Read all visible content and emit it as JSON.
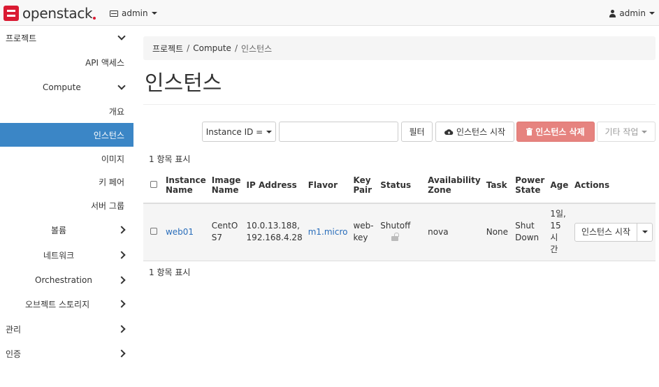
{
  "navbar": {
    "logo_text": "openstack",
    "project_selector": "admin",
    "user_menu": "admin"
  },
  "sidebar": {
    "items": [
      {
        "label": "프로젝트",
        "chevron": "down"
      },
      {
        "label": "API 액세스"
      },
      {
        "label": "Compute",
        "chevron": "down"
      },
      {
        "label": "개요"
      },
      {
        "label": "인스턴스",
        "active": true
      },
      {
        "label": "이미지"
      },
      {
        "label": "키 페어"
      },
      {
        "label": "서버 그룹"
      },
      {
        "label": "볼륨",
        "chevron": "right"
      },
      {
        "label": "네트워크",
        "chevron": "right"
      },
      {
        "label": "Orchestration",
        "chevron": "right"
      },
      {
        "label": "오브젝트 스토리지",
        "chevron": "right"
      },
      {
        "label": "관리",
        "chevron": "right"
      },
      {
        "label": "인증",
        "chevron": "right"
      }
    ]
  },
  "breadcrumb": [
    "프로젝트",
    "Compute",
    "인스턴스"
  ],
  "page_title": "인스턴스",
  "toolbar": {
    "filter_field": "Instance ID =",
    "filter_value": "",
    "filter_button": "필터",
    "start_button": "인스턴스 시작",
    "delete_button": "인스턴스 삭제",
    "more_actions": "기타 작업"
  },
  "item_count": "1 항목 표시",
  "table": {
    "headers": {
      "name": [
        "Instance",
        "Name"
      ],
      "image": [
        "Image",
        "Name"
      ],
      "ip": "IP Address",
      "flavor": "Flavor",
      "keypair": [
        "Key",
        "Pair"
      ],
      "status": "Status",
      "az": [
        "Availability",
        "Zone"
      ],
      "task": "Task",
      "power": [
        "Power",
        "State"
      ],
      "age": "Age",
      "actions": "Actions"
    },
    "rows": [
      {
        "name": "web01",
        "image": [
          "CentO",
          "S7"
        ],
        "ip": [
          "10.0.13.188,",
          "192.168.4.28"
        ],
        "flavor": "m1.micro",
        "keypair": [
          "web-",
          "key"
        ],
        "status": "Shutoff",
        "az": "nova",
        "task": "None",
        "power": [
          "Shut",
          "Down"
        ],
        "age": [
          "1일,",
          "15",
          "시",
          "간"
        ],
        "action": "인스턴스 시작"
      }
    ]
  },
  "colors": {
    "active_nav": "#3b86c6",
    "link": "#2a6ebb",
    "danger_button": "#e6837f",
    "brand": "#da1a32"
  }
}
